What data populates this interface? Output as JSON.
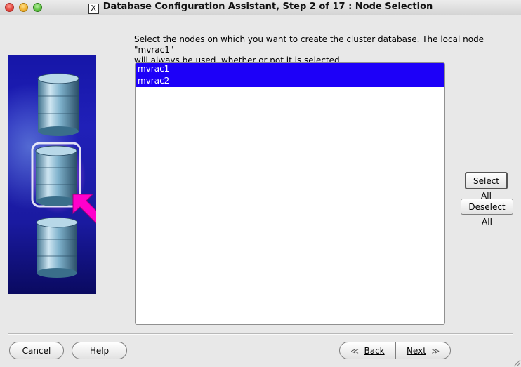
{
  "window": {
    "title": "Database Configuration Assistant, Step 2 of 17 : Node Selection"
  },
  "instruction": {
    "line1": "Select the nodes on which you want to create the cluster database. The local node \"mvrac1\"",
    "line2": "will always be used, whether or not it is selected."
  },
  "nodes": [
    {
      "label": "mvrac1",
      "selected": true
    },
    {
      "label": "mvrac2",
      "selected": true
    }
  ],
  "buttons": {
    "select_all": "Select All",
    "deselect_all": "Deselect All",
    "cancel": "Cancel",
    "help": "Help",
    "back": "Back",
    "next": "Next"
  },
  "colors": {
    "selection": "#1d00f8",
    "banner": "#1a1aa8",
    "arrow": "#ff00cc"
  }
}
